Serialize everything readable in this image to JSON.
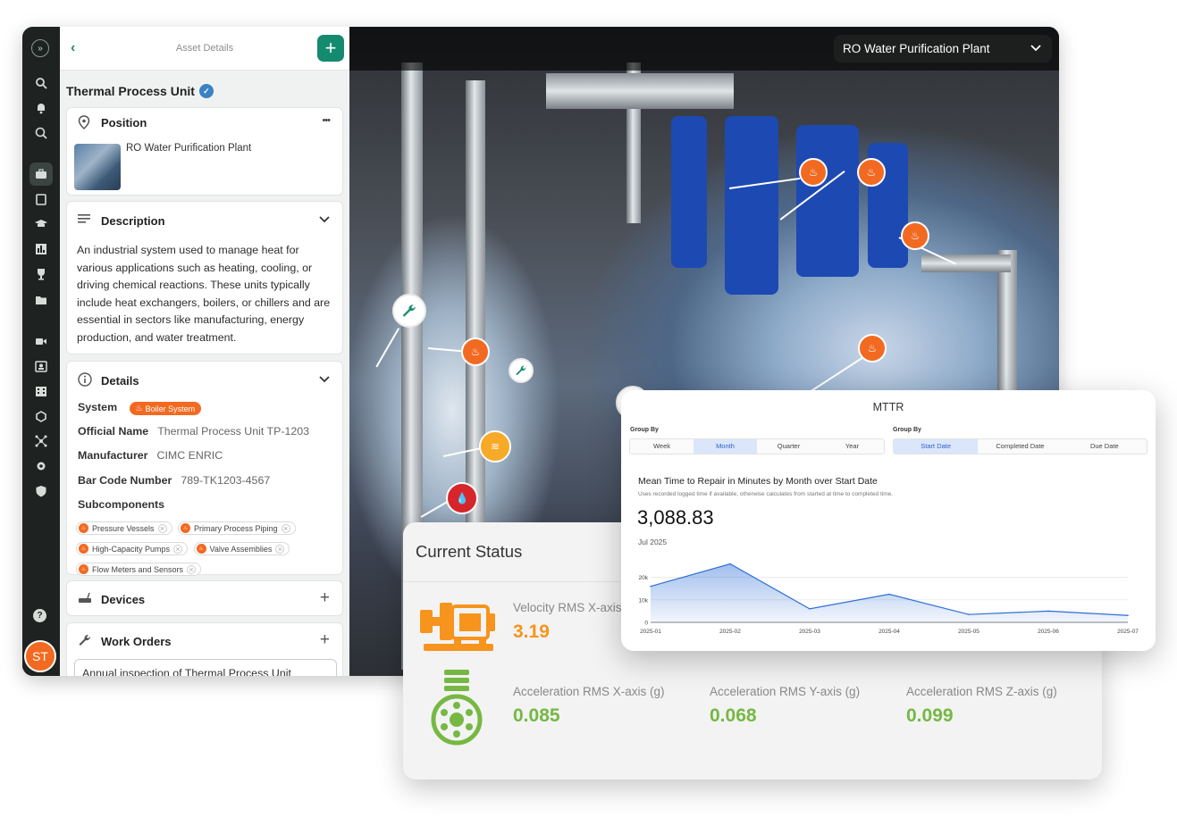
{
  "rail": {
    "avatar_initials": "ST",
    "help_label": "?",
    "expand_label": "»"
  },
  "panel": {
    "header_title": "Asset Details",
    "back_label": "‹",
    "add_label": "+",
    "asset_name": "Thermal Process Unit",
    "position": {
      "title": "Position",
      "menu_label": "•••",
      "location": "RO Water Purification Plant"
    },
    "description": {
      "title": "Description",
      "text": "An industrial system used to manage heat for various applications such as heating, cooling, or driving chemical reactions. These units typically include heat exchangers, boilers, or chillers and are essential in sectors like manufacturing, energy production, and water treatment."
    },
    "details": {
      "title": "Details",
      "system_label": "System",
      "system_value": "Boiler System",
      "official_name_label": "Official Name",
      "official_name_value": "Thermal Process Unit TP-1203",
      "manufacturer_label": "Manufacturer",
      "manufacturer_value": "CIMC ENRIC",
      "barcode_label": "Bar Code Number",
      "barcode_value": "789-TK1203-4567",
      "subcomponents_label": "Subcomponents",
      "subcomponents": [
        "Pressure Vessels",
        "Primary Process Piping",
        "High-Capacity Pumps",
        "Valve Assemblies",
        "Flow Meters and Sensors"
      ]
    },
    "devices": {
      "title": "Devices",
      "add_label": "+"
    },
    "work_orders": {
      "title": "Work Orders",
      "add_label": "+",
      "first_item": "Annual inspection of Thermal Process Unit"
    }
  },
  "scene": {
    "site_selector": "RO Water Purification Plant"
  },
  "status": {
    "title": "Current Status",
    "velocity_label": "Velocity RMS X-axis",
    "velocity_value": "3.19",
    "accel_x_label": "Acceleration RMS X-axis (g)",
    "accel_x_value": "0.085",
    "accel_y_label": "Acceleration RMS Y-axis (g)",
    "accel_y_value": "0.068",
    "accel_z_label": "Acceleration RMS Z-axis (g)",
    "accel_z_value": "0.099",
    "colors": {
      "orange": "#f7941d",
      "green": "#76b843"
    }
  },
  "mttr": {
    "title": "MTTR",
    "group_by_label_1": "Group By",
    "group_by_label_2": "Group By",
    "period_tabs": [
      "Week",
      "Month",
      "Quarter",
      "Year"
    ],
    "period_selected": "Month",
    "date_tabs": [
      "Start Date",
      "Completed Date",
      "Due Date"
    ],
    "date_selected": "Start Date",
    "subtitle": "Mean Time to Repair in Minutes by Month over Start Date",
    "note": "Uses recorded logged time if available, otherwise calculates from started at time to completed time.",
    "big_value": "3,088.83",
    "period_label": "Jul 2025"
  },
  "chart_data": {
    "type": "area",
    "x": [
      "2025-01",
      "2025-02",
      "2025-03",
      "2025-04",
      "2025-05",
      "2025-06",
      "2025-07"
    ],
    "values": [
      16000,
      26000,
      6000,
      12500,
      3500,
      5000,
      3089
    ],
    "ylim": [
      0,
      27000
    ],
    "yticks": [
      0,
      10000,
      20000
    ],
    "ytick_labels": [
      "0",
      "10k",
      "20k"
    ],
    "grid": true,
    "color": "#2f6fd6"
  }
}
